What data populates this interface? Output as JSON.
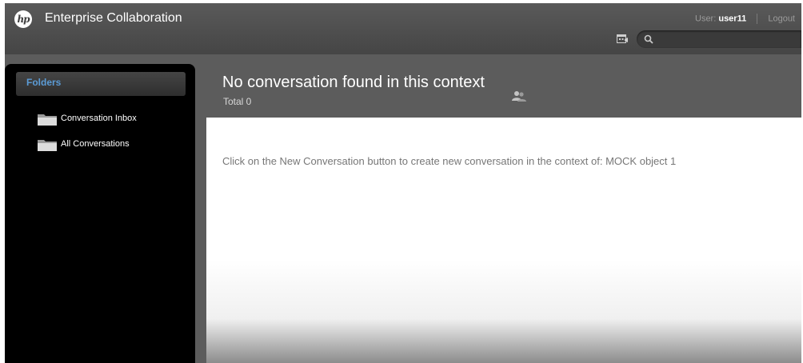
{
  "header": {
    "logo_text": "hp",
    "app_title": "Enterprise Collaboration",
    "user_label": "User:",
    "user_name": "user11",
    "logout_label": "Logout",
    "search_placeholder": ""
  },
  "icons": {
    "logo": "hp-logo",
    "calendar": "calendar-icon",
    "search": "search-icon",
    "folder": "folder-icon",
    "participants": "people-icon"
  },
  "sidebar": {
    "title": "Folders",
    "items": [
      {
        "label": "Conversation Inbox"
      },
      {
        "label": "All Conversations"
      }
    ]
  },
  "main": {
    "title": "No conversation found in this context",
    "total": "Total 0",
    "message": "Click on the New Conversation button to create new conversation in the context of: MOCK object 1"
  },
  "colors": {
    "header_bg": "#4f4f4f",
    "frame_bg": "#5c5c5c",
    "sidebar_bg": "#000000",
    "accent": "#5b9bd5",
    "message_text": "#777777"
  }
}
